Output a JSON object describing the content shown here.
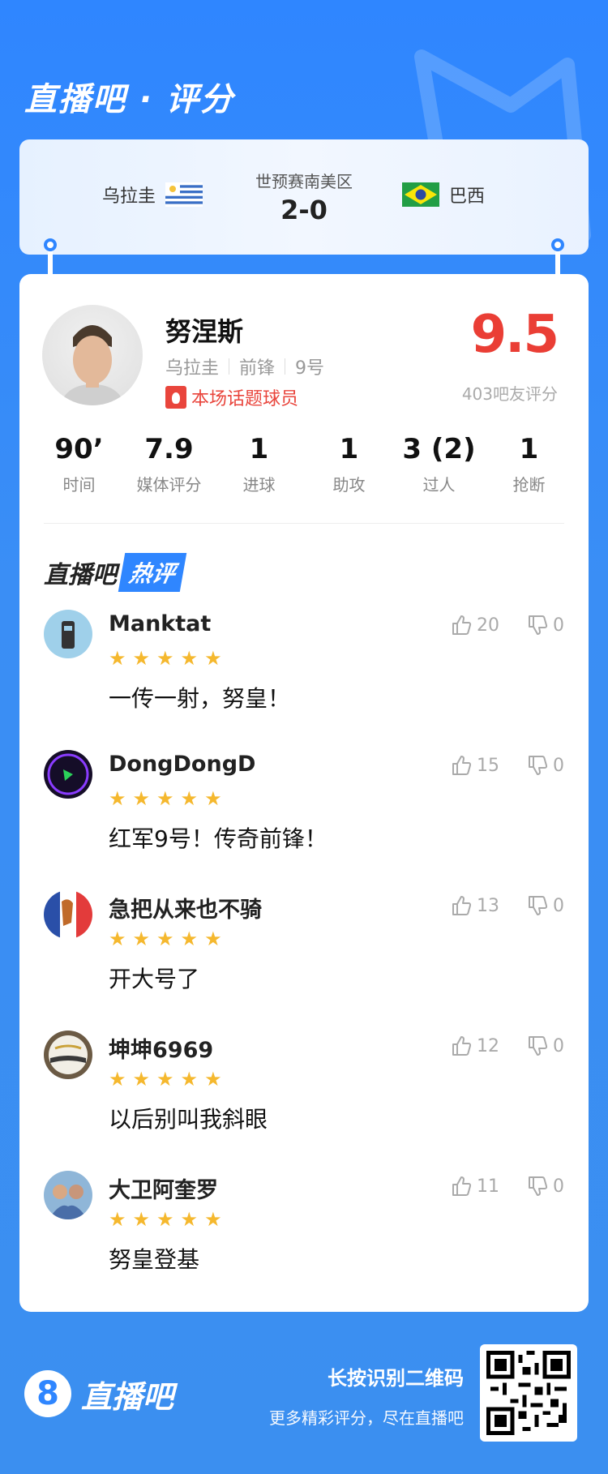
{
  "header": {
    "brand_title": "直播吧 · 评分"
  },
  "match": {
    "home_team": "乌拉圭",
    "away_team": "巴西",
    "competition": "世预赛南美区",
    "score": "2-0"
  },
  "player": {
    "name": "努涅斯",
    "nation": "乌拉圭",
    "position": "前锋",
    "number": "9号",
    "hot_tag": "本场话题球员",
    "rating": "9.5",
    "rating_count": "403吧友评分"
  },
  "stats": [
    {
      "value": "90’",
      "label": "时间"
    },
    {
      "value": "7.9",
      "label": "媒体评分"
    },
    {
      "value": "1",
      "label": "进球"
    },
    {
      "value": "1",
      "label": "助攻"
    },
    {
      "value": "3 (2)",
      "label": "过人"
    },
    {
      "value": "1",
      "label": "抢断"
    }
  ],
  "hot_section": {
    "title_left": "直播吧",
    "title_right": "热评"
  },
  "comments": [
    {
      "user": "Manktat",
      "stars": 5,
      "text": "一传一射，努皇！",
      "likes": "20",
      "dislikes": "0"
    },
    {
      "user": "DongDongD",
      "stars": 5,
      "text": "红军9号！传奇前锋！",
      "likes": "15",
      "dislikes": "0"
    },
    {
      "user": "急把从来也不骑",
      "stars": 5,
      "text": "开大号了",
      "likes": "13",
      "dislikes": "0"
    },
    {
      "user": "坤坤6969",
      "stars": 5,
      "text": "以后别叫我斜眼",
      "likes": "12",
      "dislikes": "0"
    },
    {
      "user": "大卫阿奎罗",
      "stars": 5,
      "text": "努皇登基",
      "likes": "11",
      "dislikes": "0"
    }
  ],
  "footer": {
    "logo_number": "8",
    "logo_text": "直播吧",
    "qr_title": "长按识别二维码",
    "qr_subtitle": "更多精彩评分，尽在直播吧"
  },
  "colors": {
    "accent": "#2f86ff",
    "rating": "#ea3e35",
    "star": "#f5b82e"
  }
}
